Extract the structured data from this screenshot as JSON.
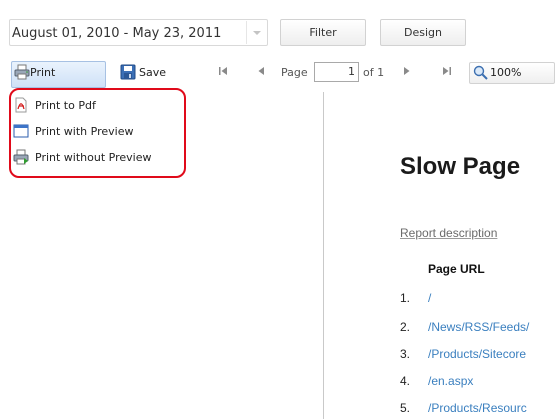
{
  "date_range": {
    "value": "August 01, 2010 - May 23, 2011"
  },
  "header_buttons": {
    "filter": "Filter",
    "design": "Design"
  },
  "toolbar": {
    "print": "Print",
    "save": "Save",
    "page_label": "Page",
    "page_value": "1",
    "of_label": "of 1",
    "zoom": "100%"
  },
  "print_menu": {
    "items": [
      {
        "label": "Print to Pdf",
        "icon": "pdf-icon"
      },
      {
        "label": "Print with Preview",
        "icon": "preview-window-icon"
      },
      {
        "label": "Print without Preview",
        "icon": "printer-icon"
      }
    ],
    "highlight_color": "#e00a1a"
  },
  "report": {
    "title": "Slow Page",
    "description_link": "Report description",
    "column_header": "Page URL",
    "rows": [
      {
        "num": "1.",
        "url": "/"
      },
      {
        "num": "2.",
        "url": "/News/RSS/Feeds/"
      },
      {
        "num": "3.",
        "url": "/Products/Sitecore"
      },
      {
        "num": "4.",
        "url": "/en.aspx"
      },
      {
        "num": "5.",
        "url": "/Products/Resourc"
      }
    ],
    "link_color": "#3a7fbf"
  }
}
